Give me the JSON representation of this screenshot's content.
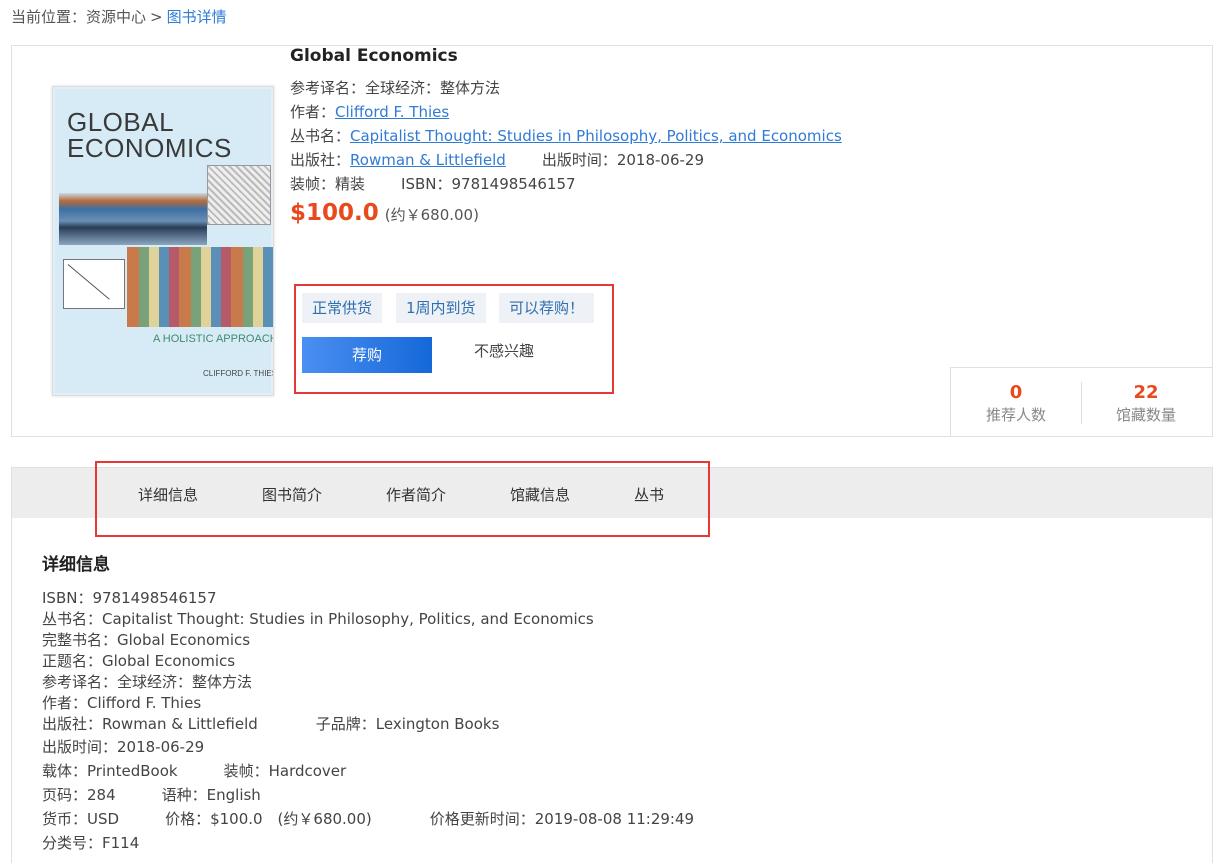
{
  "breadcrumb": {
    "prefix": "当前位置：",
    "home": "资源中心",
    "sep": ">",
    "current": "图书详情"
  },
  "book": {
    "cover": {
      "title_line1": "GLOBAL",
      "title_line2": "ECONOMICS",
      "subtitle": "A HOLISTIC APPROACH",
      "author": "CLIFFORD F. THIES"
    },
    "title": "Global Economics",
    "alt_title_label": "参考译名：",
    "alt_title": "全球经济：整体方法",
    "author_label": "作者：",
    "author": "Clifford F. Thies",
    "series_label": "丛书名：",
    "series": "Capitalist Thought: Studies in Philosophy, Politics, and Economics",
    "publisher_label": "出版社：",
    "publisher": "Rowman & Littlefield",
    "pubdate_label": "出版时间：",
    "pubdate": "2018-06-29",
    "binding_label": "装帧：",
    "binding": "精装",
    "isbn_label": "ISBN：",
    "isbn": "9781498546157",
    "price_usd": "$100.0",
    "price_cny": "(约￥680.00)"
  },
  "tags": [
    "正常供货",
    "1周内到货",
    "可以荐购！"
  ],
  "actions": {
    "recommend": "荐购",
    "not_interested": "不感兴趣"
  },
  "stats": {
    "recommenders": "0",
    "recommenders_label": "推荐人数",
    "holdings": "22",
    "holdings_label": "馆藏数量"
  },
  "tabs": [
    "详细信息",
    "图书简介",
    "作者简介",
    "馆藏信息",
    "丛书"
  ],
  "detail": {
    "heading": "详细信息",
    "isbn": "ISBN：9781498546157",
    "series": "丛书名：Capitalist Thought: Studies in Philosophy, Politics, and Economics",
    "full_title": "完整书名：Global Economics",
    "proper_title": "正题名：Global Economics",
    "alt_title": "参考译名：全球经济：整体方法",
    "author": "作者：Clifford F. Thies",
    "publisher": "出版社：Rowman & Littlefield",
    "imprint": "子品牌：Lexington Books",
    "pubdate": "出版时间：2018-06-29",
    "carrier": "载体：PrintedBook",
    "binding": "装帧：Hardcover",
    "pages": "页码：284",
    "language": "语种：English",
    "currency": "货币：USD",
    "price": "价格：$100.0　(约￥680.00)",
    "price_updated": "价格更新时间：2019-08-08 11:29:49",
    "classification": "分类号：F114"
  }
}
